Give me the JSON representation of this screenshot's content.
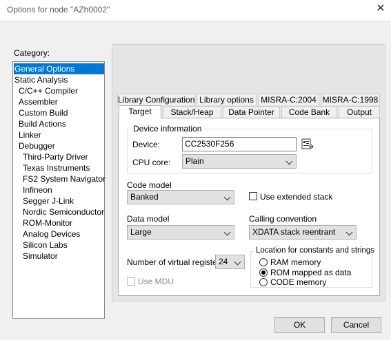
{
  "window": {
    "title": "Options for node \"AZh0002\"",
    "close_icon": "close-icon"
  },
  "category": {
    "label": "Category:",
    "items": [
      "General Options",
      "Static Analysis",
      "C/C++ Compiler",
      "Assembler",
      "Custom Build",
      "Build Actions",
      "Linker",
      "Debugger",
      "Third-Party Driver",
      "Texas Instruments",
      "FS2 System Navigator",
      "Infineon",
      "Segger J-Link",
      "Nordic Semiconductor",
      "ROM-Monitor",
      "Analog Devices",
      "Silicon Labs",
      "Simulator"
    ],
    "selected": "General Options"
  },
  "tabs": {
    "row1": [
      "Library Configuration",
      "Library options",
      "MISRA-C:2004",
      "MISRA-C:1998"
    ],
    "row2": [
      "Target",
      "Stack/Heap",
      "Data Pointer",
      "Code Bank",
      "Output"
    ],
    "active": "Target"
  },
  "device_info": {
    "group_label": "Device information",
    "device_label": "Device:",
    "device_value": "CC2530F256",
    "cpu_label": "CPU core:",
    "cpu_value": "Plain"
  },
  "code_model": {
    "label": "Code model",
    "value": "Banked"
  },
  "extended_stack": {
    "label": "Use extended stack",
    "checked": false
  },
  "data_model": {
    "label": "Data model",
    "value": "Large"
  },
  "calling_convention": {
    "label": "Calling convention",
    "value": "XDATA stack reentrant"
  },
  "virtual_registers": {
    "label": "Number of virtual registers:",
    "value": "24"
  },
  "location": {
    "group_label": "Location for constants and strings",
    "options": [
      "RAM memory",
      "ROM mapped as data",
      "CODE memory"
    ],
    "selected": "ROM mapped as data"
  },
  "use_mdu": {
    "label": "Use MDU",
    "checked": false,
    "enabled": false
  },
  "buttons": {
    "ok": "OK",
    "cancel": "Cancel"
  }
}
